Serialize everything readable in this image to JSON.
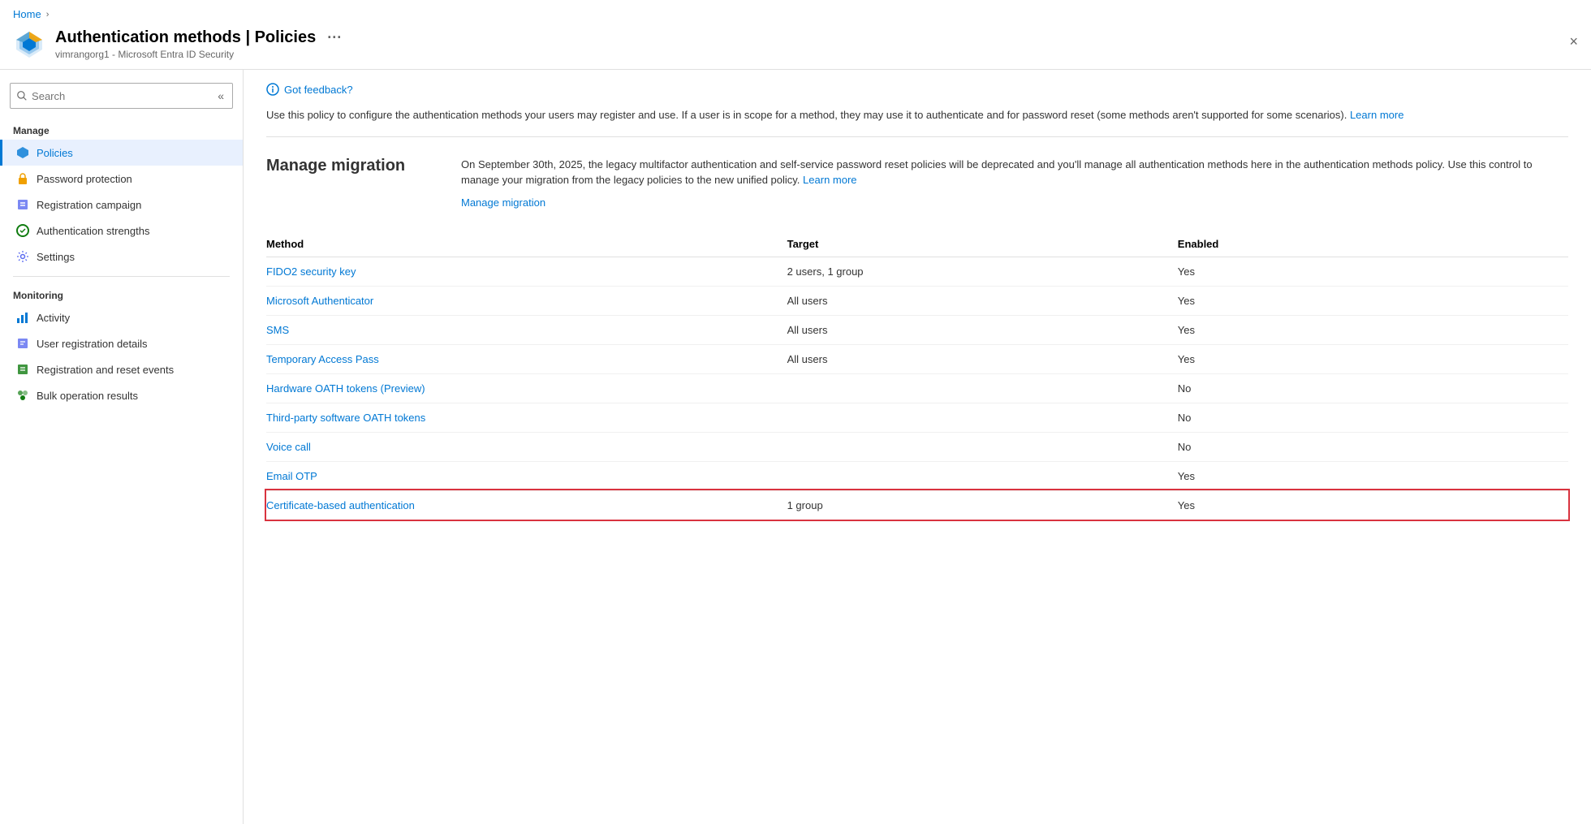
{
  "breadcrumb": {
    "items": [
      "Home"
    ]
  },
  "header": {
    "title": "Authentication methods | Policies",
    "subtitle": "vimrangorg1 - Microsoft Entra ID Security",
    "more_label": "···",
    "close_label": "×"
  },
  "sidebar": {
    "search_placeholder": "Search",
    "collapse_icon": "«",
    "manage_section": "Manage",
    "manage_items": [
      {
        "label": "Policies",
        "icon": "policies-icon",
        "active": true
      },
      {
        "label": "Password protection",
        "icon": "password-icon",
        "active": false
      },
      {
        "label": "Registration campaign",
        "icon": "regcampaign-icon",
        "active": false
      },
      {
        "label": "Authentication strengths",
        "icon": "authstrength-icon",
        "active": false
      },
      {
        "label": "Settings",
        "icon": "settings-icon",
        "active": false
      }
    ],
    "monitoring_section": "Monitoring",
    "monitoring_items": [
      {
        "label": "Activity",
        "icon": "activity-icon",
        "active": false
      },
      {
        "label": "User registration details",
        "icon": "usereg-icon",
        "active": false
      },
      {
        "label": "Registration and reset events",
        "icon": "regevents-icon",
        "active": false
      },
      {
        "label": "Bulk operation results",
        "icon": "bulkops-icon",
        "active": false
      }
    ]
  },
  "content": {
    "feedback_label": "Got feedback?",
    "policy_description": "Use this policy to configure the authentication methods your users may register and use. If a user is in scope for a method, they may use it to authenticate and for password reset (some methods aren't supported for some scenarios).",
    "policy_learn_more": "Learn more",
    "migration": {
      "title": "Manage migration",
      "description": "On September 30th, 2025, the legacy multifactor authentication and self-service password reset policies will be deprecated and you'll manage all authentication methods here in the authentication methods policy. Use this control to manage your migration from the legacy policies to the new unified policy.",
      "learn_more": "Learn more",
      "manage_link": "Manage migration"
    },
    "table": {
      "col_method": "Method",
      "col_target": "Target",
      "col_enabled": "Enabled",
      "rows": [
        {
          "method": "FIDO2 security key",
          "target": "2 users, 1 group",
          "enabled": "Yes",
          "highlighted": false
        },
        {
          "method": "Microsoft Authenticator",
          "target": "All users",
          "enabled": "Yes",
          "highlighted": false
        },
        {
          "method": "SMS",
          "target": "All users",
          "enabled": "Yes",
          "highlighted": false
        },
        {
          "method": "Temporary Access Pass",
          "target": "All users",
          "enabled": "Yes",
          "highlighted": false
        },
        {
          "method": "Hardware OATH tokens (Preview)",
          "target": "",
          "enabled": "No",
          "highlighted": false
        },
        {
          "method": "Third-party software OATH tokens",
          "target": "",
          "enabled": "No",
          "highlighted": false
        },
        {
          "method": "Voice call",
          "target": "",
          "enabled": "No",
          "highlighted": false
        },
        {
          "method": "Email OTP",
          "target": "",
          "enabled": "Yes",
          "highlighted": false
        },
        {
          "method": "Certificate-based authentication",
          "target": "1 group",
          "enabled": "Yes",
          "highlighted": true
        }
      ]
    }
  }
}
